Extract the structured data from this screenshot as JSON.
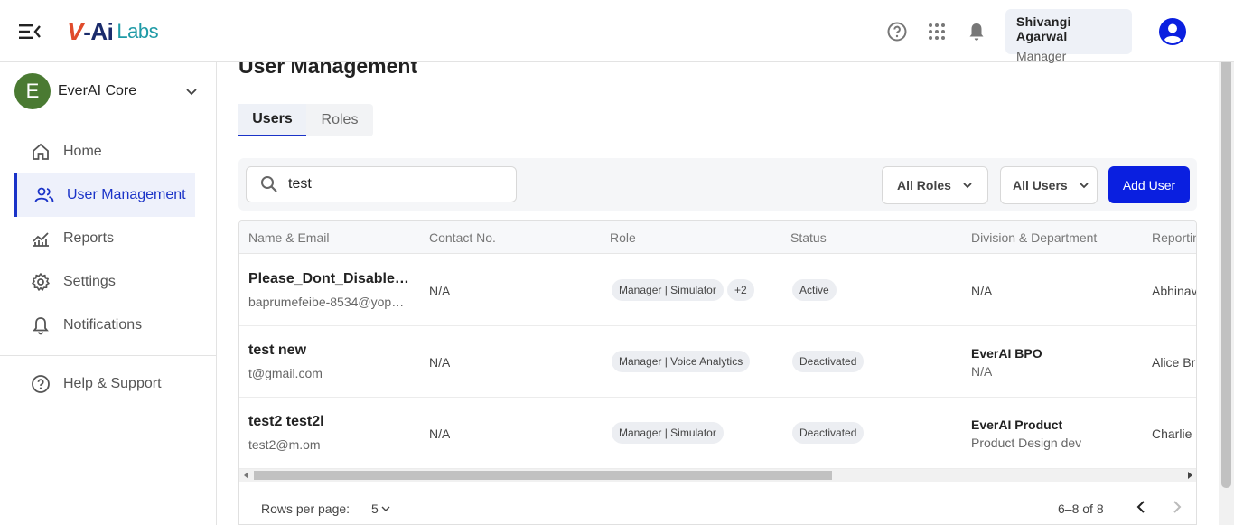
{
  "header": {
    "logo": {
      "v": "V",
      "ai": "-Ai",
      "labs": "Labs"
    },
    "user": {
      "name": "Shivangi Agarwal",
      "role": "Manager"
    },
    "icons": [
      "help-icon",
      "apps-grid-icon",
      "bell-icon",
      "account-icon"
    ]
  },
  "sidebar": {
    "org": {
      "initial": "E",
      "name": "EverAI Core"
    },
    "items": [
      {
        "label": "Home",
        "icon": "home-icon"
      },
      {
        "label": "User Management",
        "icon": "users-icon"
      },
      {
        "label": "Reports",
        "icon": "chart-icon"
      },
      {
        "label": "Settings",
        "icon": "gear-icon"
      },
      {
        "label": "Notifications",
        "icon": "bell-icon"
      }
    ],
    "help": {
      "label": "Help & Support",
      "icon": "help-icon"
    }
  },
  "main": {
    "title": "User Management",
    "tabs": [
      "Users",
      "Roles"
    ],
    "search": {
      "value": "test"
    },
    "filters": {
      "roles": "All Roles",
      "users": "All Users"
    },
    "add_button": "Add User",
    "table": {
      "headers": [
        "Name & Email",
        "Contact No.",
        "Role",
        "Status",
        "Division & Department",
        "Reportin"
      ],
      "rows": [
        {
          "name": "Please_Dont_Disable…",
          "email": "baprumefeibe-8534@yop…",
          "contact": "N/A",
          "role": "Manager | Simulator",
          "role_extra": "+2",
          "status": "Active",
          "division": "",
          "department": "N/A",
          "reporting": "Abhinav"
        },
        {
          "name": "test new",
          "email": "t@gmail.com",
          "contact": "N/A",
          "role": "Manager | Voice Analytics",
          "role_extra": "",
          "status": "Deactivated",
          "division": "EverAI BPO",
          "department": "N/A",
          "reporting": "Alice Br"
        },
        {
          "name": "test2 test2l",
          "email": "test2@m.om",
          "contact": "N/A",
          "role": "Manager | Simulator",
          "role_extra": "",
          "status": "Deactivated",
          "division": "EverAI Product",
          "department": "Product Design dev",
          "reporting": "Charlie"
        }
      ]
    },
    "pagination": {
      "rows_label": "Rows per page:",
      "rows_value": "5",
      "range": "6–8 of 8"
    }
  }
}
